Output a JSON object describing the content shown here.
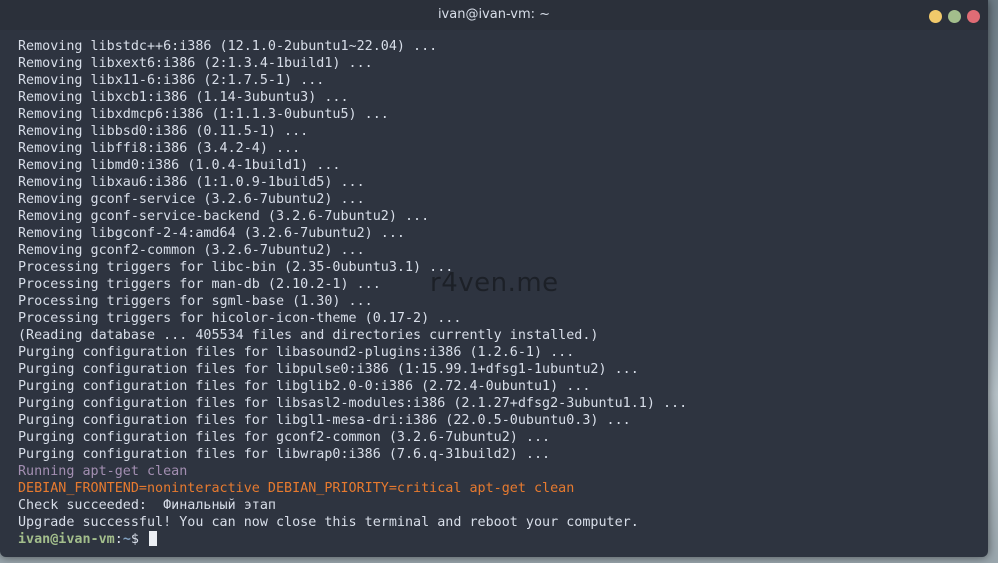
{
  "window": {
    "title": "ivan@ivan-vm: ~",
    "buttons": {
      "minimize": "minimize-icon",
      "maximize": "maximize-icon",
      "close": "close-icon"
    }
  },
  "watermark": "r4ven.me",
  "terminal": {
    "lines": [
      "Removing libstdc++6:i386 (12.1.0-2ubuntu1~22.04) ...",
      "Removing libxext6:i386 (2:1.3.4-1build1) ...",
      "Removing libx11-6:i386 (2:1.7.5-1) ...",
      "Removing libxcb1:i386 (1.14-3ubuntu3) ...",
      "Removing libxdmcp6:i386 (1:1.1.3-0ubuntu5) ...",
      "Removing libbsd0:i386 (0.11.5-1) ...",
      "Removing libffi8:i386 (3.4.2-4) ...",
      "Removing libmd0:i386 (1.0.4-1build1) ...",
      "Removing libxau6:i386 (1:1.0.9-1build5) ...",
      "Removing gconf-service (3.2.6-7ubuntu2) ...",
      "Removing gconf-service-backend (3.2.6-7ubuntu2) ...",
      "Removing libgconf-2-4:amd64 (3.2.6-7ubuntu2) ...",
      "Removing gconf2-common (3.2.6-7ubuntu2) ...",
      "Processing triggers for libc-bin (2.35-0ubuntu3.1) ...",
      "Processing triggers for man-db (2.10.2-1) ...",
      "Processing triggers for sgml-base (1.30) ...",
      "Processing triggers for hicolor-icon-theme (0.17-2) ...",
      "(Reading database ... 405534 files and directories currently installed.)",
      "Purging configuration files for libasound2-plugins:i386 (1.2.6-1) ...",
      "Purging configuration files for libpulse0:i386 (1:15.99.1+dfsg1-1ubuntu2) ...",
      "Purging configuration files for libglib2.0-0:i386 (2.72.4-0ubuntu1) ...",
      "Purging configuration files for libsasl2-modules:i386 (2.1.27+dfsg2-3ubuntu1.1) ...",
      "Purging configuration files for libgl1-mesa-dri:i386 (22.0.5-0ubuntu0.3) ...",
      "Purging configuration files for gconf2-common (3.2.6-7ubuntu2) ...",
      "Purging configuration files for libwrap0:i386 (7.6.q-31build2) ..."
    ],
    "running_line": "Running apt-get clean",
    "command_line": "DEBIAN_FRONTEND=noninteractive DEBIAN_PRIORITY=critical apt-get clean",
    "check_line": "Check succeeded:  Финальный этап",
    "upgrade_line": "Upgrade successful! You can now close this terminal and reboot your computer.",
    "prompt": {
      "user_host": "ivan@ivan-vm",
      "separator": ":",
      "path": "~",
      "symbol": "$ "
    }
  },
  "colors": {
    "terminal_bg": "#2e3440",
    "text": "#d8dee9",
    "running": "#a38fb2",
    "command": "#e77a2f",
    "prompt_user": "#a3be8c",
    "prompt_path": "#81a1c1"
  }
}
